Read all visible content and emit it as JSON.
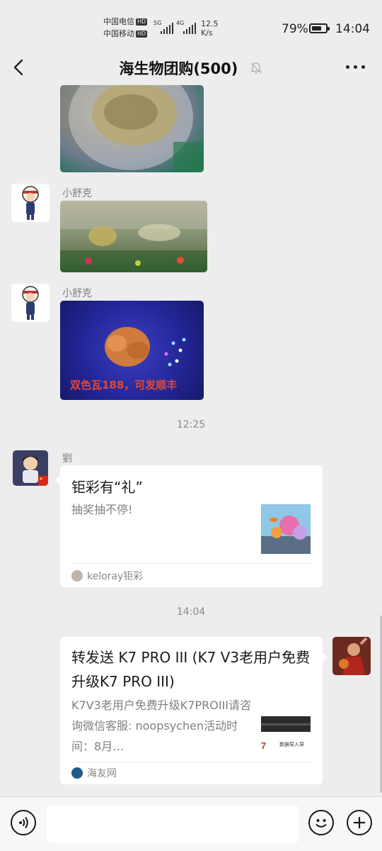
{
  "status_bar": {
    "carrier1": "中国电信",
    "carrier2": "中国移动",
    "hd_badge": "HD",
    "net1": "5G",
    "net2": "4G",
    "speed_value": "12.5",
    "speed_unit": "K/s",
    "battery_pct_text": "79%",
    "battery_level": 0.79,
    "time": "14:04"
  },
  "header": {
    "title": "海生物团购(500)",
    "back_icon": "chevron-left-icon",
    "mute_icon": "bell-off-icon",
    "more_icon": "more-dots-icon"
  },
  "messages": {
    "msg2": {
      "sender": "小舒克"
    },
    "msg3": {
      "sender": "小舒克",
      "overlay_text": "双色瓦188，可发顺丰"
    },
    "time1": "12:25",
    "msg4": {
      "sender": "劉",
      "title": "钜彩有“礼”",
      "desc": "抽奖抽不停!",
      "source": "keloray钜彩"
    },
    "time2": "14:04",
    "msg5": {
      "title": "转发送 K7 PRO III (K7 V3老用户免费升级K7 PRO III)",
      "desc": "K7V3老用户免费升级K7PROIII请咨询微信客服: noopsychen活动时间：8月…",
      "source": "海友网",
      "thumb_text": "数据导入导"
    }
  },
  "input_bar": {
    "voice_icon": "voice-icon",
    "emoji_icon": "emoji-icon",
    "plus_icon": "plus-icon",
    "placeholder": ""
  },
  "colors": {
    "background": "#ededed",
    "bubble": "#ffffff",
    "text": "#191919",
    "meta_text": "#808080"
  }
}
